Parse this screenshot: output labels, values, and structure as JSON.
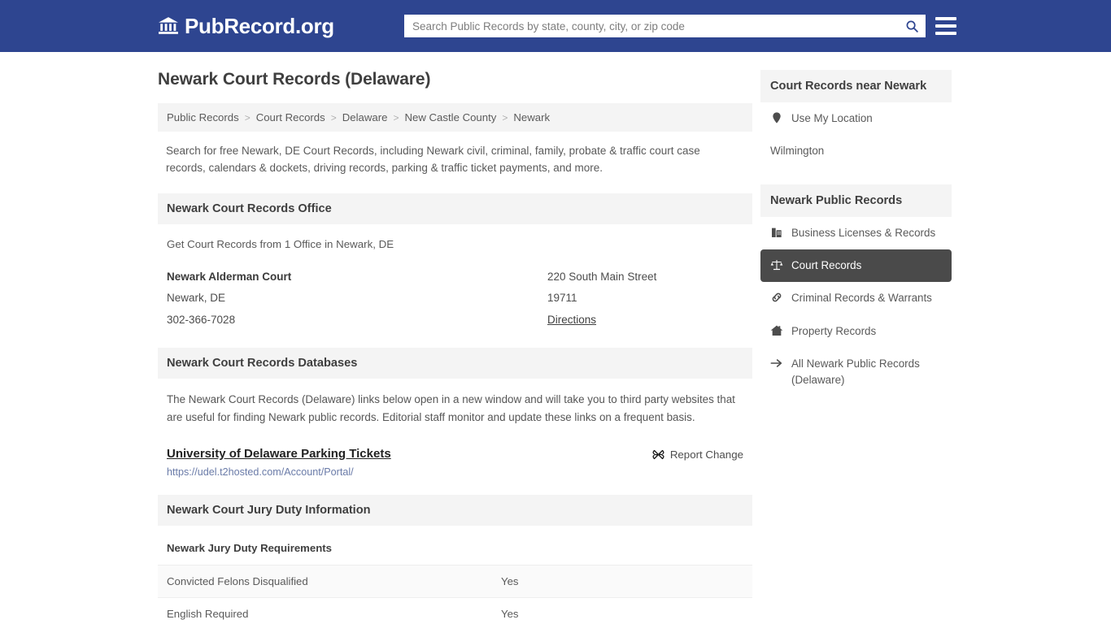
{
  "header": {
    "logo_text": "PubRecord.org",
    "logo_icon": "bank-building-icon",
    "search_placeholder": "Search Public Records by state, county, city, or zip code",
    "search_value": "",
    "search_icon": "search-icon",
    "menu_icon": "hamburger-menu-icon"
  },
  "page": {
    "title": "Newark Court Records (Delaware)",
    "intro": "Search for free Newark, DE Court Records, including Newark civil, criminal, family, probate & traffic court case records, calendars & dockets, driving records, parking & traffic ticket payments, and more."
  },
  "breadcrumb": {
    "separator": ">",
    "items": [
      {
        "label": "Public Records"
      },
      {
        "label": "Court Records"
      },
      {
        "label": "Delaware"
      },
      {
        "label": "New Castle County"
      },
      {
        "label": "Newark"
      }
    ]
  },
  "office_section": {
    "heading": "Newark Court Records Office",
    "note": "Get Court Records from 1 Office in Newark, DE",
    "office": {
      "name": "Newark Alderman Court",
      "city_state": "Newark, DE",
      "phone": "302-366-7028",
      "street": "220 South Main Street",
      "zip": "19711",
      "directions_label": "Directions"
    }
  },
  "databases_section": {
    "heading": "Newark Court Records Databases",
    "description": "The Newark Court Records (Delaware) links below open in a new window and will take you to third party websites that are useful for finding Newark public records. Editorial staff monitor and update these links on a frequent basis.",
    "entries": [
      {
        "title": "University of Delaware Parking Tickets",
        "url": "https://udel.t2hosted.com/Account/Portal/",
        "report_label": "Report Change",
        "report_icon": "broken-link-icon"
      }
    ]
  },
  "jury_section": {
    "heading": "Newark Court Jury Duty Information",
    "subheading": "Newark Jury Duty Requirements",
    "rows": [
      {
        "label": "Convicted Felons Disqualified",
        "value": "Yes"
      },
      {
        "label": "English Required",
        "value": "Yes"
      }
    ]
  },
  "sidebar": {
    "near_heading": "Court Records near Newark",
    "use_my_location": {
      "label": "Use My Location",
      "icon": "map-pin-icon"
    },
    "nearby": [
      {
        "label": "Wilmington"
      }
    ],
    "public_records_heading": "Newark Public Records",
    "links": [
      {
        "label": "Business Licenses & Records",
        "icon": "briefcase-icon",
        "active": false
      },
      {
        "label": "Court Records",
        "icon": "scales-of-justice-icon",
        "active": true
      },
      {
        "label": "Criminal Records & Warrants",
        "icon": "chain-link-icon",
        "active": false
      },
      {
        "label": "Property Records",
        "icon": "house-icon",
        "active": false
      },
      {
        "label": "All Newark Public Records (Delaware)",
        "icon": "arrow-right-icon",
        "active": false
      }
    ]
  },
  "colors": {
    "header_blue": "#2e4590",
    "section_gray": "#f4f4f4",
    "active_dark": "#4a4a4a",
    "link_blue": "#6a7ba8"
  }
}
